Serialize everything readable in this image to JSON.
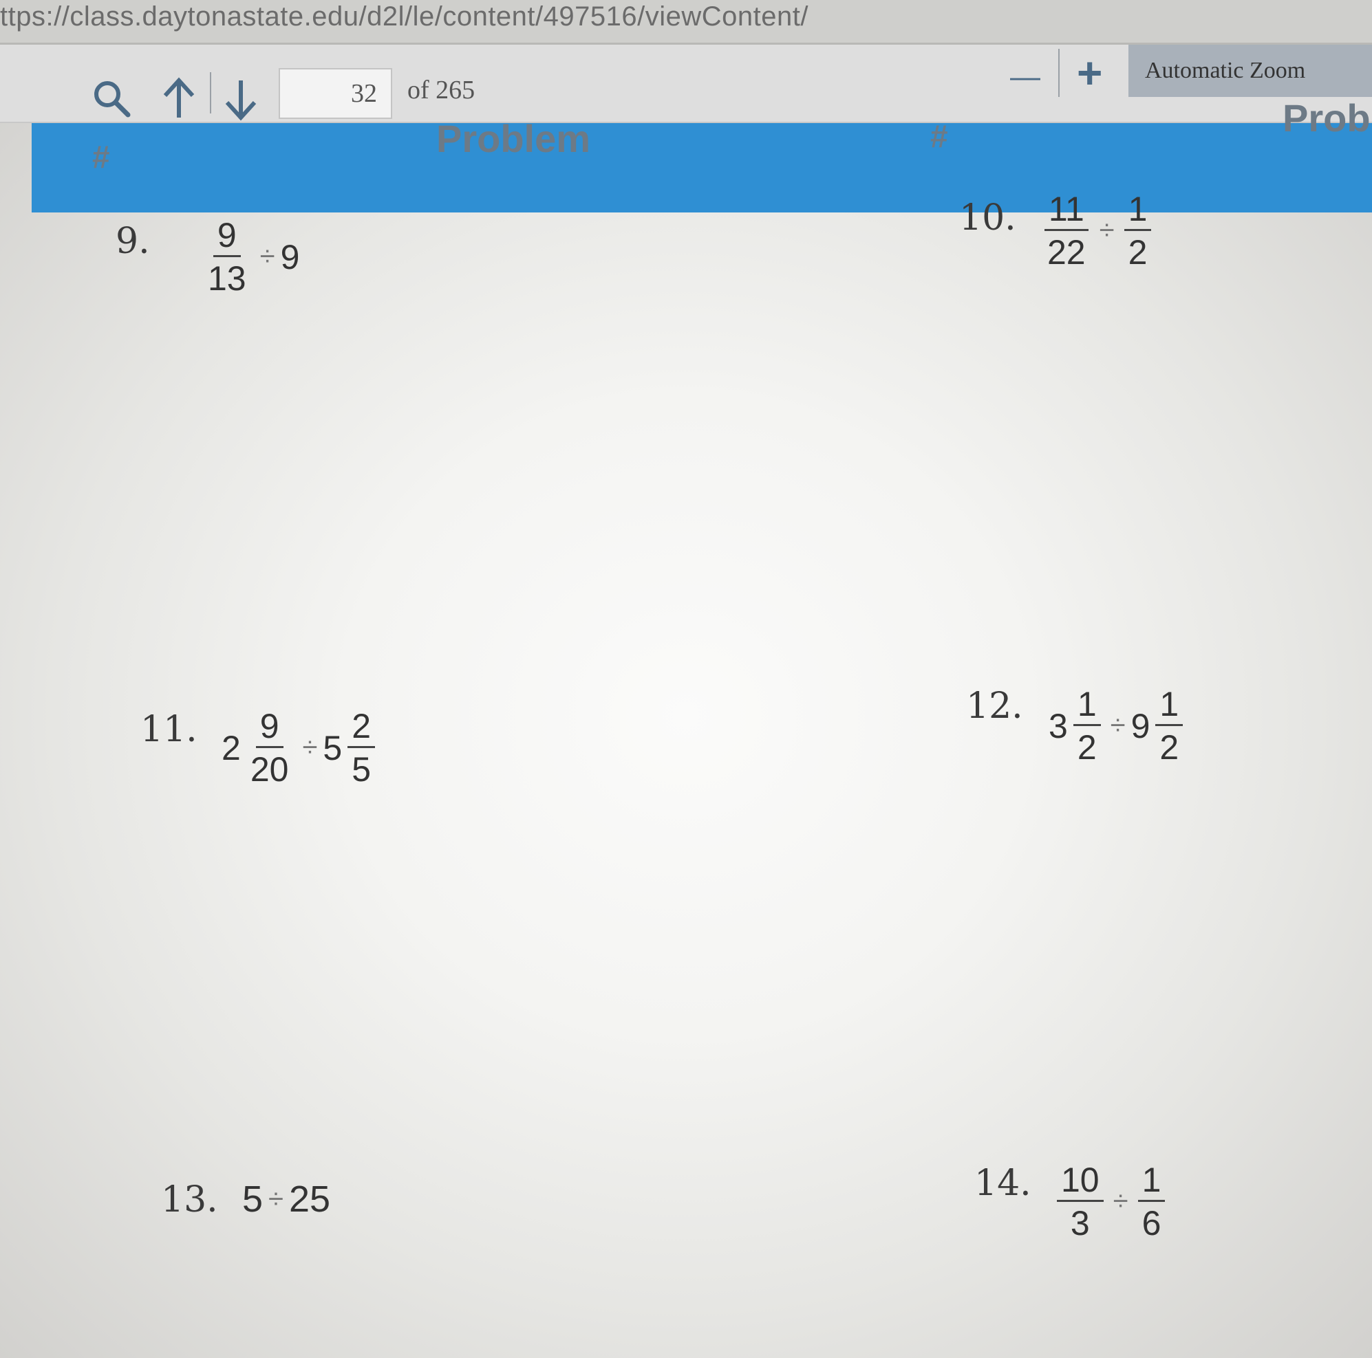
{
  "browser": {
    "url": "ttps://class.daytonastate.edu/d2l/le/content/497516/viewContent/"
  },
  "pdf_toolbar": {
    "page_number": "32",
    "page_total": "of 265",
    "zoom_out": "—",
    "zoom_in": "+",
    "zoom_mode": "Automatic Zoom"
  },
  "table_header": {
    "col1_hash": "#",
    "col1_title": "Problem",
    "col2_hash": "#",
    "col2_title": "Prob"
  },
  "problems": {
    "p9": {
      "num": "9.",
      "a_num": "9",
      "a_den": "13",
      "op": "÷",
      "b": "9"
    },
    "p10": {
      "num": "10.",
      "a_num": "11",
      "a_den": "22",
      "op": "÷",
      "b_num": "1",
      "b_den": "2"
    },
    "p11": {
      "num": "11.",
      "a_whole": "2",
      "a_num": "9",
      "a_den": "20",
      "op": "÷",
      "b_whole": "5",
      "b_num": "2",
      "b_den": "5"
    },
    "p12": {
      "num": "12.",
      "a_whole": "3",
      "a_num": "1",
      "a_den": "2",
      "op": "÷",
      "b_whole": "9",
      "b_num": "1",
      "b_den": "2"
    },
    "p13": {
      "num": "13.",
      "a": "5",
      "op": "÷",
      "b": "25"
    },
    "p14": {
      "num": "14.",
      "a_num": "10",
      "a_den": "3",
      "op": "÷",
      "b_num": "1",
      "b_den": "6"
    }
  }
}
